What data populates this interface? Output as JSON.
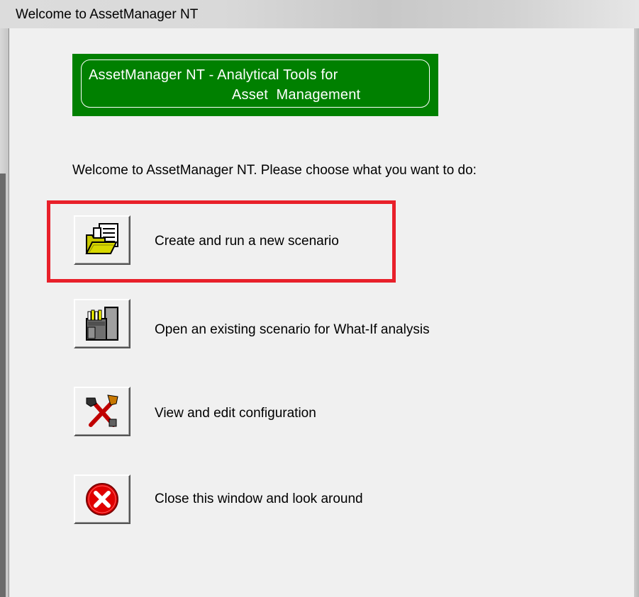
{
  "window": {
    "title": "Welcome to AssetManager NT"
  },
  "banner": {
    "line1": "AssetManager NT - Analytical Tools for",
    "line2": "Asset  Management",
    "color": "#008000"
  },
  "prompt": "Welcome to AssetManager NT. Please choose what you want to do:",
  "actions": [
    {
      "label": "Create and run a new scenario",
      "icon": "folder-document-icon",
      "highlighted": true,
      "highlight_color": "#e8202a"
    },
    {
      "label": "Open an existing scenario for What-If analysis",
      "icon": "file-cabinet-icon",
      "highlighted": false
    },
    {
      "label": "View and edit configuration",
      "icon": "tools-icon",
      "highlighted": false
    },
    {
      "label": "Close this window and look around",
      "icon": "close-circle-icon",
      "highlighted": false
    }
  ]
}
